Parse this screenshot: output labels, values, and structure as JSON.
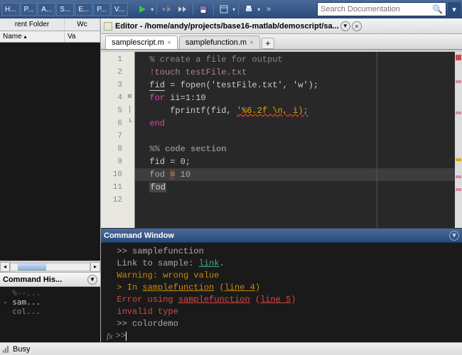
{
  "top_tabs": [
    "H...",
    "P...",
    "A...",
    "S...",
    "E...",
    "P...",
    "V..."
  ],
  "search": {
    "placeholder": "Search Documentation"
  },
  "left": {
    "folder": {
      "tabs": [
        "rent Folder",
        "Wc"
      ],
      "col_name": "Name",
      "col_val": "Va"
    },
    "history": {
      "title": "Command His...",
      "lines": [
        "%--...",
        "sam...",
        "col..."
      ]
    }
  },
  "editor": {
    "title": "Editor - /home/andy/projects/base16-matlab/demoscript/sa...",
    "tabs": [
      {
        "label": "samplescript.m",
        "active": true
      },
      {
        "label": "samplefunction.m",
        "active": false
      }
    ],
    "lines": 12,
    "code": {
      "l1_comment": "% create a file for output",
      "l2_bang": "!",
      "l2_cmd": "touch testFile.txt",
      "l3_var": "fid",
      "l3_rest": " = fopen('testFile.txt', 'w');",
      "l4_for": "for",
      "l4_rest": " ii=1:10",
      "l5_fn": "fprintf(fid, ",
      "l5_str": "'%6.2f \\n, i);",
      "l6_end": "end",
      "l8_sec": "%% code section",
      "l9": "fid = 0;",
      "l10_a": "fod ",
      "l10_b": "=",
      "l10_c": " 10",
      "l11": "fod"
    }
  },
  "cmd": {
    "title": "Command Window",
    "prompt": ">>",
    "l1": "samplefunction",
    "l2a": "Link to sample: ",
    "l2b": "link",
    "l2c": ".",
    "l3": "Warning: wrong value",
    "l4a": "> In ",
    "l4b": "samplefunction",
    "l4c": " (",
    "l4d": "line 4",
    "l4e": ")",
    "l5a": "Error using ",
    "l5b": "samplefunction",
    "l5c": " (",
    "l5d": "line 5",
    "l5e": ")",
    "l6": "invalid type",
    "l7": "colordemo",
    "fx": "fx"
  },
  "status": {
    "text": "Busy"
  }
}
